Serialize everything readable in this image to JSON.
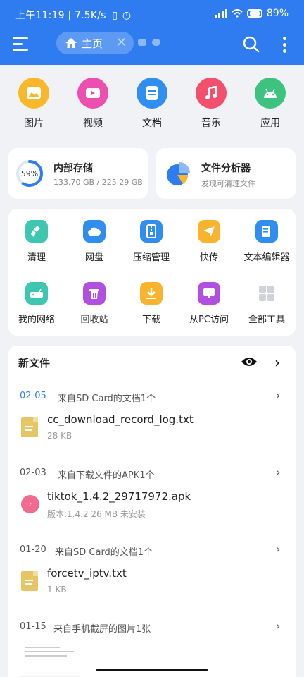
{
  "status_bar": {
    "left": "上午11:19 | 7.5K/s",
    "battery": "89%"
  },
  "header": {
    "tab_label": "主页",
    "tab_close": "✕"
  },
  "categories": [
    {
      "label": "图片",
      "color": "#f9b72c",
      "icon": "image-icon"
    },
    {
      "label": "视频",
      "color": "#ec4fb0",
      "icon": "video-icon"
    },
    {
      "label": "文档",
      "color": "#2f8ef0",
      "icon": "document-icon"
    },
    {
      "label": "音乐",
      "color": "#f44f6c",
      "icon": "music-icon"
    },
    {
      "label": "应用",
      "color": "#3ec27f",
      "icon": "android-icon"
    }
  ],
  "storage": {
    "title": "内部存储",
    "percent": "59%",
    "used_fraction": 0.59,
    "detail": "133.70 GB / 225.29 GB"
  },
  "analyzer": {
    "title": "文件分析器",
    "subtitle": "发现可清理文件"
  },
  "tools": [
    {
      "label": "清理",
      "color": "#3fc6b0",
      "icon": "broom-icon"
    },
    {
      "label": "网盘",
      "color": "#2f8ef0",
      "icon": "cloud-icon"
    },
    {
      "label": "压缩管理",
      "color": "#2f8ef0",
      "icon": "zip-icon"
    },
    {
      "label": "快传",
      "color": "#f7b42c",
      "icon": "send-icon"
    },
    {
      "label": "文本编辑器",
      "color": "#2f8ef0",
      "icon": "text-editor-icon"
    },
    {
      "label": "我的网络",
      "color": "#3fc6b0",
      "icon": "router-icon"
    },
    {
      "label": "回收站",
      "color": "#b04fe0",
      "icon": "trash-icon"
    },
    {
      "label": "下载",
      "color": "#f7b42c",
      "icon": "download-icon"
    },
    {
      "label": "从PC访问",
      "color": "#b04fe0",
      "icon": "pc-icon"
    },
    {
      "label": "全部工具",
      "color": "#cfd3d9",
      "icon": "grid-icon"
    }
  ],
  "new_files": {
    "title": "新文件",
    "groups": [
      {
        "date": "02-05",
        "source": "来自SD Card的文档1个",
        "file": "cc_download_record_log.txt",
        "meta": "28 KB",
        "kind": "txt"
      },
      {
        "date": "02-03",
        "source": "来自下载文件的APK1个",
        "file": "tiktok_1.4.2_29717972.apk",
        "meta": "版本:1.4.2  26 MB  未安装",
        "kind": "apk"
      },
      {
        "date": "01-20",
        "source": "来自SD Card的文档1个",
        "file": "forcetv_iptv.txt",
        "meta": "1 KB",
        "kind": "txt"
      },
      {
        "date": "01-15",
        "source": "来自手机截屏的图片1张"
      }
    ]
  },
  "colors": {
    "accent": "#2f7cf0",
    "first_date": "#2f7cf0"
  }
}
